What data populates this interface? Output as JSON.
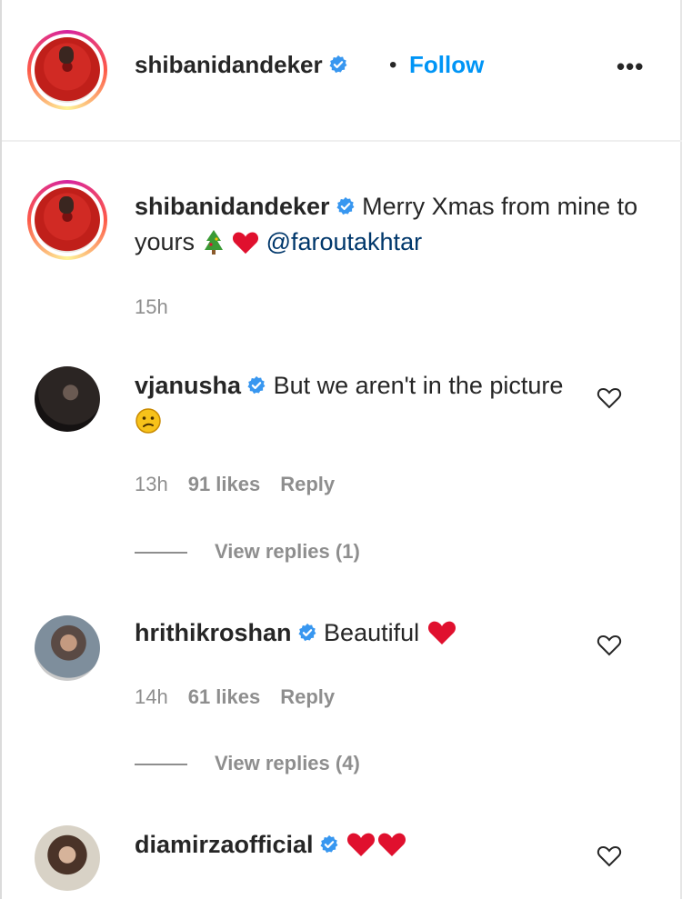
{
  "post": {
    "author": "shibanidandeker",
    "follow_label": "Follow",
    "dot": "•",
    "more_label": "•••"
  },
  "caption": {
    "username": "shibanidandeker",
    "text": "Merry Xmas from mine to yours",
    "mention": "@faroutakhtar",
    "time": "15h"
  },
  "comments": [
    {
      "username": "vjanusha",
      "text": "But we aren't in the picture",
      "time": "13h",
      "likes": "91 likes",
      "reply_label": "Reply",
      "view_replies": "View replies (1)"
    },
    {
      "username": "hrithikroshan",
      "text": "Beautiful",
      "time": "14h",
      "likes": "61 likes",
      "reply_label": "Reply",
      "view_replies": "View replies (4)"
    },
    {
      "username": "diamirzaofficial",
      "text": ""
    }
  ],
  "colors": {
    "follow_blue": "#0095f6",
    "verified_blue": "#3897f0",
    "heart_red": "#e0102e",
    "meta_grey": "#8e8e8e",
    "mention_blue": "#00376b"
  }
}
